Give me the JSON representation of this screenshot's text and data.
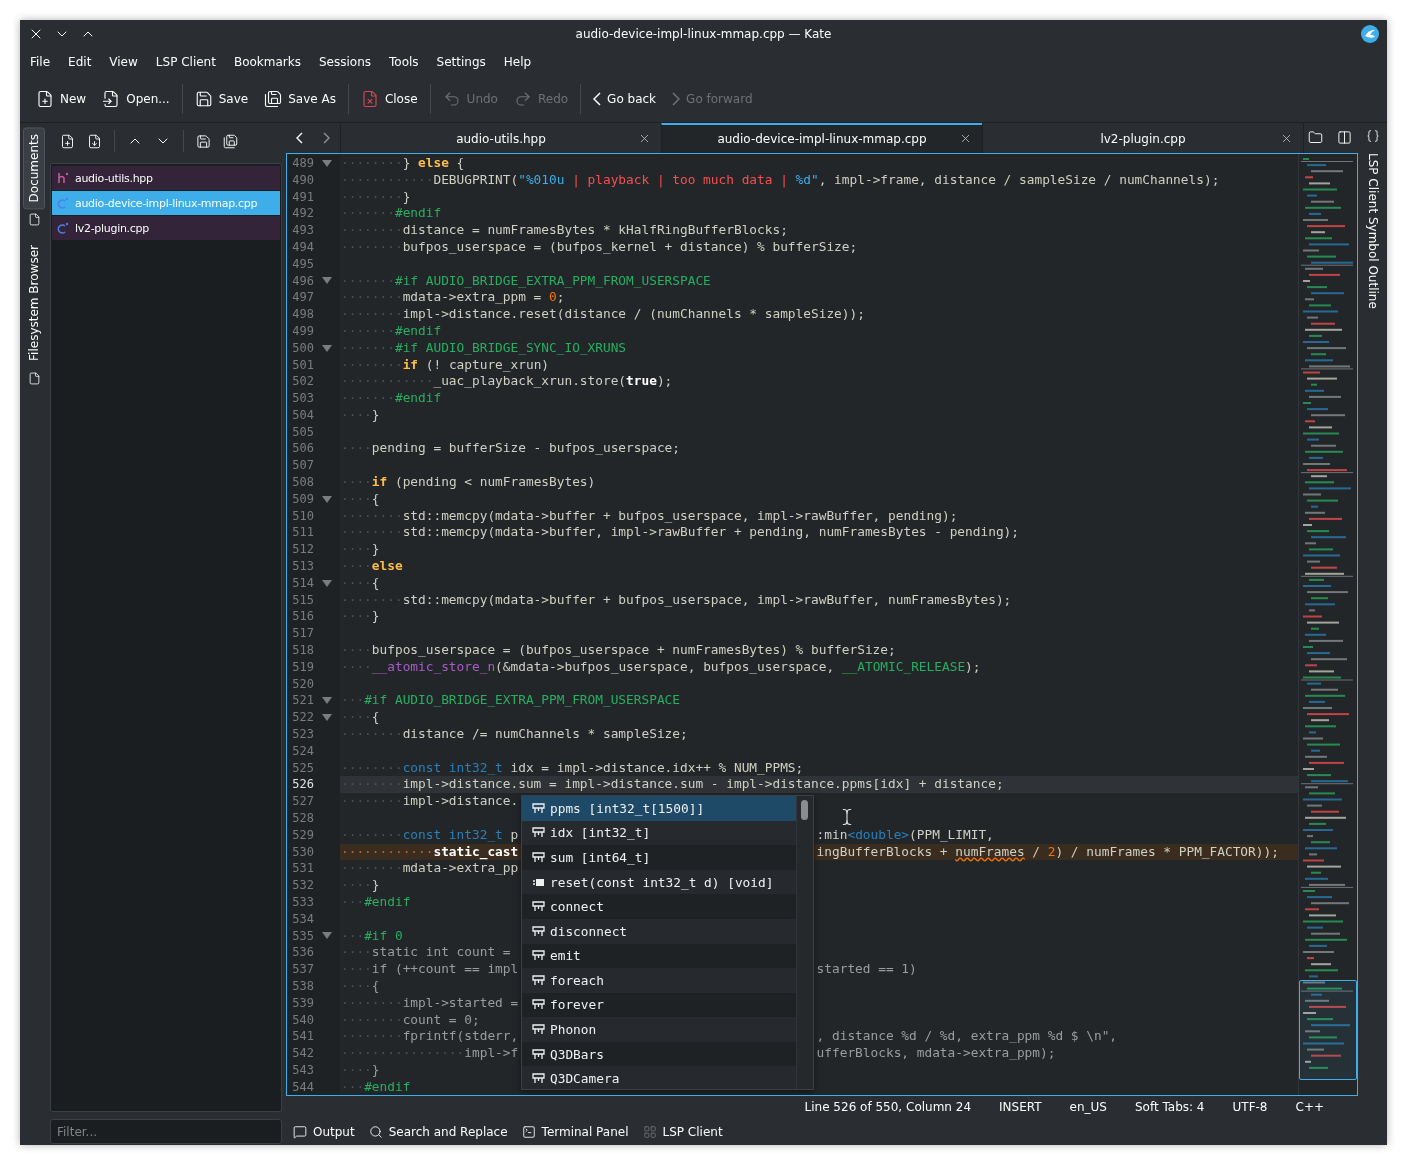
{
  "window": {
    "title": "audio-device-impl-linux-mmap.cpp — Kate"
  },
  "menu": [
    "File",
    "Edit",
    "View",
    "LSP Client",
    "Bookmarks",
    "Sessions",
    "Tools",
    "Settings",
    "Help"
  ],
  "toolbar": [
    [
      {
        "label": "New",
        "kind": "new",
        "disabled": false
      },
      {
        "label": "Open...",
        "kind": "open",
        "disabled": false
      }
    ],
    [
      {
        "label": "Save",
        "kind": "save",
        "disabled": false
      },
      {
        "label": "Save As",
        "kind": "saveas",
        "disabled": false
      }
    ],
    [
      {
        "label": "Close",
        "kind": "close",
        "disabled": false
      }
    ],
    [
      {
        "label": "Undo",
        "kind": "undo",
        "disabled": true
      },
      {
        "label": "Redo",
        "kind": "redo",
        "disabled": true
      }
    ],
    [
      {
        "label": "Go back",
        "kind": "back",
        "disabled": false
      },
      {
        "label": "Go forward",
        "kind": "forward",
        "disabled": true
      }
    ]
  ],
  "side_tabs": [
    {
      "label": "Documents",
      "selected": true
    },
    {
      "label": "Filesystem Browser",
      "selected": false
    }
  ],
  "documents": {
    "items": [
      {
        "name": "audio-utils.hpp",
        "kind": "header",
        "selected": false
      },
      {
        "name": "audio-device-impl-linux-mmap.cpp",
        "kind": "source",
        "selected": true
      },
      {
        "name": "lv2-plugin.cpp",
        "kind": "source",
        "selected": false
      }
    ],
    "filter_placeholder": "Filter..."
  },
  "editor": {
    "tabs": [
      {
        "label": "audio-utils.hpp",
        "selected": false
      },
      {
        "label": "audio-device-impl-linux-mmap.cpp",
        "selected": true
      },
      {
        "label": "lv2-plugin.cpp",
        "selected": false
      }
    ],
    "lines": [
      {
        "n": "489",
        "kind": "normal",
        "fold": true,
        "code": [
          {
            "kind": "ws",
            "text": "········"
          },
          {
            "kind": "plain",
            "text": "} "
          },
          {
            "kind": "kw",
            "text": "else"
          },
          {
            "kind": "plain",
            "text": " {"
          }
        ]
      },
      {
        "n": "490",
        "kind": "normal",
        "fold": false,
        "code": [
          {
            "kind": "ws",
            "text": "············"
          },
          {
            "kind": "plain",
            "text": "DEBUGPRINT("
          },
          {
            "kind": "fmt",
            "text": "\"%010u"
          },
          {
            "kind": "str",
            "text": " | playback | too much data | "
          },
          {
            "kind": "fmt",
            "text": "%d\""
          },
          {
            "kind": "plain",
            "text": ", impl->frame, distance / sampleSize / numChannels);"
          }
        ]
      },
      {
        "n": "491",
        "kind": "normal",
        "fold": false,
        "code": [
          {
            "kind": "ws",
            "text": "········"
          },
          {
            "kind": "plain",
            "text": "}"
          }
        ]
      },
      {
        "n": "492",
        "kind": "normal",
        "fold": false,
        "code": [
          {
            "kind": "ws",
            "text": "·······"
          },
          {
            "kind": "pp",
            "text": "#endif"
          }
        ]
      },
      {
        "n": "493",
        "kind": "normal",
        "fold": false,
        "code": [
          {
            "kind": "ws",
            "text": "········"
          },
          {
            "kind": "plain",
            "text": "distance = numFramesBytes * kHalfRingBufferBlocks;"
          }
        ]
      },
      {
        "n": "494",
        "kind": "normal",
        "fold": false,
        "code": [
          {
            "kind": "ws",
            "text": "········"
          },
          {
            "kind": "plain",
            "text": "bufpos_userspace = (bufpos_kernel + distance) % bufferSize;"
          }
        ]
      },
      {
        "n": "495",
        "kind": "normal",
        "fold": false
      },
      {
        "n": "496",
        "kind": "normal",
        "fold": true,
        "code": [
          {
            "kind": "ws",
            "text": "·······"
          },
          {
            "kind": "pp",
            "text": "#if AUDIO_BRIDGE_EXTRA_PPM_FROM_USERSPACE"
          }
        ]
      },
      {
        "n": "497",
        "kind": "normal",
        "fold": false,
        "code": [
          {
            "kind": "ws",
            "text": "········"
          },
          {
            "kind": "plain",
            "text": "mdata->extra_ppm = "
          },
          {
            "kind": "num",
            "text": "0"
          },
          {
            "kind": "plain",
            "text": ";"
          }
        ]
      },
      {
        "n": "498",
        "kind": "normal",
        "fold": false,
        "code": [
          {
            "kind": "ws",
            "text": "········"
          },
          {
            "kind": "plain",
            "text": "impl->distance.reset(distance / (numChannels * sampleSize));"
          }
        ]
      },
      {
        "n": "499",
        "kind": "normal",
        "fold": false,
        "code": [
          {
            "kind": "ws",
            "text": "·······"
          },
          {
            "kind": "pp",
            "text": "#endif"
          }
        ]
      },
      {
        "n": "500",
        "kind": "normal",
        "fold": true,
        "code": [
          {
            "kind": "ws",
            "text": "·······"
          },
          {
            "kind": "pp",
            "text": "#if AUDIO_BRIDGE_SYNC_IO_XRUNS"
          }
        ]
      },
      {
        "n": "501",
        "kind": "normal",
        "fold": false,
        "code": [
          {
            "kind": "ws",
            "text": "········"
          },
          {
            "kind": "kw",
            "text": "if"
          },
          {
            "kind": "plain",
            "text": " (! capture_xrun)"
          }
        ]
      },
      {
        "n": "502",
        "kind": "normal",
        "fold": false,
        "code": [
          {
            "kind": "ws",
            "text": "············"
          },
          {
            "kind": "plain",
            "text": "_uac_playback_xrun.store("
          },
          {
            "kind": "bold",
            "text": "true"
          },
          {
            "kind": "plain",
            "text": ");"
          }
        ]
      },
      {
        "n": "503",
        "kind": "normal",
        "fold": false,
        "code": [
          {
            "kind": "ws",
            "text": "·······"
          },
          {
            "kind": "pp",
            "text": "#endif"
          }
        ]
      },
      {
        "n": "504",
        "kind": "normal",
        "fold": false,
        "code": [
          {
            "kind": "ws",
            "text": "····"
          },
          {
            "kind": "plain",
            "text": "}"
          }
        ]
      },
      {
        "n": "505",
        "kind": "normal",
        "fold": false
      },
      {
        "n": "506",
        "kind": "normal",
        "fold": false,
        "code": [
          {
            "kind": "ws",
            "text": "····"
          },
          {
            "kind": "plain",
            "text": "pending = bufferSize - bufpos_userspace;"
          }
        ]
      },
      {
        "n": "507",
        "kind": "normal",
        "fold": false
      },
      {
        "n": "508",
        "kind": "normal",
        "fold": false,
        "code": [
          {
            "kind": "ws",
            "text": "····"
          },
          {
            "kind": "kw",
            "text": "if"
          },
          {
            "kind": "plain",
            "text": " (pending < numFramesBytes)"
          }
        ]
      },
      {
        "n": "509",
        "kind": "normal",
        "fold": true,
        "code": [
          {
            "kind": "ws",
            "text": "····"
          },
          {
            "kind": "plain",
            "text": "{"
          }
        ]
      },
      {
        "n": "510",
        "kind": "normal",
        "fold": false,
        "code": [
          {
            "kind": "ws",
            "text": "········"
          },
          {
            "kind": "plain",
            "text": "std::memcpy(mdata->buffer + bufpos_userspace, impl->rawBuffer, pending);"
          }
        ]
      },
      {
        "n": "511",
        "kind": "normal",
        "fold": false,
        "code": [
          {
            "kind": "ws",
            "text": "········"
          },
          {
            "kind": "plain",
            "text": "std::memcpy(mdata->buffer, impl->rawBuffer + pending, numFramesBytes - pending);"
          }
        ]
      },
      {
        "n": "512",
        "kind": "normal",
        "fold": false,
        "code": [
          {
            "kind": "ws",
            "text": "····"
          },
          {
            "kind": "plain",
            "text": "}"
          }
        ]
      },
      {
        "n": "513",
        "kind": "normal",
        "fold": false,
        "code": [
          {
            "kind": "ws",
            "text": "····"
          },
          {
            "kind": "kw",
            "text": "else"
          }
        ]
      },
      {
        "n": "514",
        "kind": "normal",
        "fold": true,
        "code": [
          {
            "kind": "ws",
            "text": "····"
          },
          {
            "kind": "plain",
            "text": "{"
          }
        ]
      },
      {
        "n": "515",
        "kind": "normal",
        "fold": false,
        "code": [
          {
            "kind": "ws",
            "text": "········"
          },
          {
            "kind": "plain",
            "text": "std::memcpy(mdata->buffer + bufpos_userspace, impl->rawBuffer, numFramesBytes);"
          }
        ]
      },
      {
        "n": "516",
        "kind": "normal",
        "fold": false,
        "code": [
          {
            "kind": "ws",
            "text": "····"
          },
          {
            "kind": "plain",
            "text": "}"
          }
        ]
      },
      {
        "n": "517",
        "kind": "normal",
        "fold": false
      },
      {
        "n": "518",
        "kind": "normal",
        "fold": false,
        "code": [
          {
            "kind": "ws",
            "text": "····"
          },
          {
            "kind": "plain",
            "text": "bufpos_userspace = (bufpos_userspace + numFramesBytes) % bufferSize;"
          }
        ]
      },
      {
        "n": "519",
        "kind": "normal",
        "fold": false,
        "code": [
          {
            "kind": "ws",
            "text": "····"
          },
          {
            "kind": "fn",
            "text": "__atomic_store_n"
          },
          {
            "kind": "plain",
            "text": "(&mdata->bufpos_userspace, bufpos_userspace, "
          },
          {
            "kind": "pp",
            "text": "__ATOMIC_RELEASE"
          },
          {
            "kind": "plain",
            "text": ");"
          }
        ]
      },
      {
        "n": "520",
        "kind": "normal",
        "fold": false
      },
      {
        "n": "521",
        "kind": "normal",
        "fold": true,
        "code": [
          {
            "kind": "ws",
            "text": "···"
          },
          {
            "kind": "pp",
            "text": "#if AUDIO_BRIDGE_EXTRA_PPM_FROM_USERSPACE"
          }
        ]
      },
      {
        "n": "522",
        "kind": "normal",
        "fold": true,
        "code": [
          {
            "kind": "ws",
            "text": "····"
          },
          {
            "kind": "plain",
            "text": "{"
          }
        ]
      },
      {
        "n": "523",
        "kind": "normal",
        "fold": false,
        "code": [
          {
            "kind": "ws",
            "text": "········"
          },
          {
            "kind": "plain",
            "text": "distance /= numChannels * sampleSize;"
          }
        ]
      },
      {
        "n": "524",
        "kind": "normal",
        "fold": false
      },
      {
        "n": "525",
        "kind": "normal",
        "fold": false,
        "code": [
          {
            "kind": "ws",
            "text": "········"
          },
          {
            "kind": "type",
            "text": "const int32_t"
          },
          {
            "kind": "plain",
            "text": " idx = impl->distance.idx++ % NUM_PPMS;"
          }
        ]
      },
      {
        "n": "526",
        "kind": "current",
        "fold": false,
        "code": [
          {
            "kind": "ws",
            "text": "········"
          },
          {
            "kind": "plain",
            "text": "impl->distance.sum = impl->distance.sum - impl->distance.ppms[idx] + distance;"
          }
        ]
      },
      {
        "n": "527",
        "kind": "normal",
        "fold": false,
        "code": [
          {
            "kind": "ws",
            "text": "········"
          },
          {
            "kind": "plain",
            "text": "impl->distance."
          }
        ]
      },
      {
        "n": "528",
        "kind": "normal",
        "fold": false
      },
      {
        "n": "529",
        "kind": "normal",
        "fold": false,
        "code": [
          {
            "kind": "ws",
            "text": "········"
          },
          {
            "kind": "type",
            "text": "const int32_t"
          },
          {
            "kind": "plain",
            "text": " p"
          }
        ],
        "tail": [
          {
            "kind": "plain",
            "text": ":min"
          },
          {
            "kind": "type",
            "text": "<double>"
          },
          {
            "kind": "plain",
            "text": "(PPM_LIMIT,"
          }
        ]
      },
      {
        "n": "530",
        "kind": "warning",
        "fold": false,
        "code": [
          {
            "kind": "mark",
            "text": "············"
          },
          {
            "kind": "bold",
            "text": "static_cast"
          }
        ],
        "tail": [
          {
            "kind": "plain",
            "text": "ingBufferBlocks + "
          },
          {
            "kind": "err",
            "text": "numFrames"
          },
          {
            "kind": "plain",
            "text": " / "
          },
          {
            "kind": "num",
            "text": "2"
          },
          {
            "kind": "plain",
            "text": ") / numFrames * PPM_FACTOR));"
          }
        ]
      },
      {
        "n": "531",
        "kind": "normal",
        "fold": false,
        "code": [
          {
            "kind": "ws",
            "text": "········"
          },
          {
            "kind": "plain",
            "text": "mdata->extra_pp"
          }
        ]
      },
      {
        "n": "532",
        "kind": "normal",
        "fold": false,
        "code": [
          {
            "kind": "ws",
            "text": "····"
          },
          {
            "kind": "plain",
            "text": "}"
          }
        ]
      },
      {
        "n": "533",
        "kind": "normal",
        "fold": false,
        "code": [
          {
            "kind": "ws",
            "text": "···"
          },
          {
            "kind": "pp",
            "text": "#endif"
          }
        ]
      },
      {
        "n": "534",
        "kind": "normal",
        "fold": false
      },
      {
        "n": "535",
        "kind": "normal",
        "fold": true,
        "code": [
          {
            "kind": "ws",
            "text": "···"
          },
          {
            "kind": "pp",
            "text": "#if 0"
          }
        ]
      },
      {
        "n": "536",
        "kind": "normal",
        "fold": false,
        "code": [
          {
            "kind": "ws",
            "text": "····"
          },
          {
            "kind": "dim",
            "text": "static int count ="
          }
        ]
      },
      {
        "n": "537",
        "kind": "normal",
        "fold": false,
        "code": [
          {
            "kind": "ws",
            "text": "····"
          },
          {
            "kind": "dim",
            "text": "if (++count == impl"
          }
        ],
        "tail": [
          {
            "kind": "dim",
            "text": "started == 1)"
          }
        ]
      },
      {
        "n": "538",
        "kind": "normal",
        "fold": false,
        "code": [
          {
            "kind": "ws",
            "text": "····"
          },
          {
            "kind": "dim",
            "text": "{"
          }
        ]
      },
      {
        "n": "539",
        "kind": "normal",
        "fold": false,
        "code": [
          {
            "kind": "ws",
            "text": "········"
          },
          {
            "kind": "dim",
            "text": "impl->started ="
          }
        ]
      },
      {
        "n": "540",
        "kind": "normal",
        "fold": false,
        "code": [
          {
            "kind": "ws",
            "text": "········"
          },
          {
            "kind": "dim",
            "text": "count = 0;"
          }
        ]
      },
      {
        "n": "541",
        "kind": "normal",
        "fold": false,
        "code": [
          {
            "kind": "ws",
            "text": "········"
          },
          {
            "kind": "dim",
            "text": "fprintf(stderr,"
          }
        ],
        "tail": [
          {
            "kind": "dim",
            "text": ", distance %d / %d, extra_ppm %d $ \\n\","
          }
        ]
      },
      {
        "n": "542",
        "kind": "normal",
        "fold": false,
        "code": [
          {
            "kind": "ws",
            "text": "················"
          },
          {
            "kind": "dim",
            "text": "impl->f"
          }
        ],
        "tail": [
          {
            "kind": "dim",
            "text": "ufferBlocks, mdata->extra_ppm);"
          }
        ]
      },
      {
        "n": "543",
        "kind": "normal",
        "fold": false,
        "code": [
          {
            "kind": "ws",
            "text": "····"
          },
          {
            "kind": "dim",
            "text": "}"
          }
        ]
      },
      {
        "n": "544",
        "kind": "normal",
        "fold": false,
        "code": [
          {
            "kind": "ws",
            "text": "···"
          },
          {
            "kind": "pp",
            "text": "#endif"
          }
        ]
      }
    ],
    "completion": [
      {
        "label": "ppms [int32_t[1500]]",
        "kind": "member",
        "selected": true
      },
      {
        "label": "idx [int32_t]",
        "kind": "member",
        "selected": false
      },
      {
        "label": "sum [int64_t]",
        "kind": "member",
        "selected": false
      },
      {
        "label": "reset(const int32_t d) [void]",
        "kind": "method",
        "selected": false
      },
      {
        "label": "connect",
        "kind": "member",
        "selected": false
      },
      {
        "label": "disconnect",
        "kind": "member",
        "selected": false
      },
      {
        "label": "emit",
        "kind": "member",
        "selected": false
      },
      {
        "label": "foreach",
        "kind": "member",
        "selected": false
      },
      {
        "label": "forever",
        "kind": "member",
        "selected": false
      },
      {
        "label": "Phonon",
        "kind": "member",
        "selected": false
      },
      {
        "label": "Q3DBars",
        "kind": "member",
        "selected": false
      },
      {
        "label": "Q3DCamera",
        "kind": "member",
        "selected": false
      }
    ],
    "status": [
      "Line 526 of 550, Column 24",
      "INSERT",
      "en_US",
      "Soft Tabs: 4",
      "UTF-8",
      "C++"
    ]
  },
  "right_panel": {
    "label": "LSP Client Symbol Outline"
  },
  "bottom_tabs": [
    {
      "label": "Output",
      "kind": "output"
    },
    {
      "label": "Search and Replace",
      "kind": "search"
    },
    {
      "label": "Terminal Panel",
      "kind": "terminal"
    },
    {
      "label": "LSP Client",
      "kind": "lsp"
    }
  ]
}
